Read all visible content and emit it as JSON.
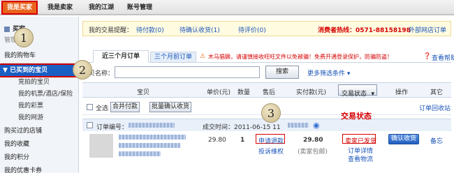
{
  "nav": {
    "tabs": [
      "我是买家",
      "我是卖家",
      "我的江湖",
      "账号管理"
    ]
  },
  "sidebar": {
    "group_title": "买家",
    "group_subtitle": "管理",
    "items": [
      "我的购物车",
      "已买到的宝贝",
      "竞拍的宝贝",
      "我的机票/酒店/保险",
      "我的彩票",
      "我的网游",
      "购买过的店铺",
      "我的收藏",
      "我的积分",
      "我的优惠卡券"
    ]
  },
  "badges": [
    "1",
    "2",
    "3"
  ],
  "notice": {
    "label": "我的交易提醒：",
    "pay": "待付款(0)",
    "confirm": "待确认收货(1)",
    "review": "待评价(0)",
    "hotline": "消费者热线：0571-88158198",
    "external": "外部网店订单"
  },
  "tabs": {
    "recent": "近三个月订单",
    "older": "三个月前订单",
    "warning": "木马猖獗，请谨慎接收旺旺文件以免被骗！免费开通登录保护，防骗防盗！",
    "help": "查看帮助"
  },
  "search": {
    "label": "宝贝名称：",
    "button": "搜索",
    "more": "更多筛选条件"
  },
  "table_header": {
    "item": "宝贝",
    "price": "单价(元)",
    "qty": "数量",
    "aftersale": "售后",
    "paid": "实付款(元)",
    "status": "交易状态",
    "op": "操作",
    "other": "其它"
  },
  "toolbar": {
    "select_all": "全选",
    "merge_pay": "合并付款",
    "batch_confirm": "批量确认收货",
    "recycle": "订单回收站"
  },
  "order": {
    "number_label": "订单编号：",
    "time": "成交时间：2011-06-15 11",
    "price": "29.80",
    "qty": "1",
    "refund": "申请退款",
    "complaint": "投诉维权",
    "paid": "29.80",
    "paid_note": "(卖家包邮)",
    "status": "卖家已发货",
    "detail": "订单详情",
    "logistics": "查看物流",
    "confirm_btn": "确认收货",
    "memo": "备忘",
    "status_annotation": "交易状态"
  }
}
